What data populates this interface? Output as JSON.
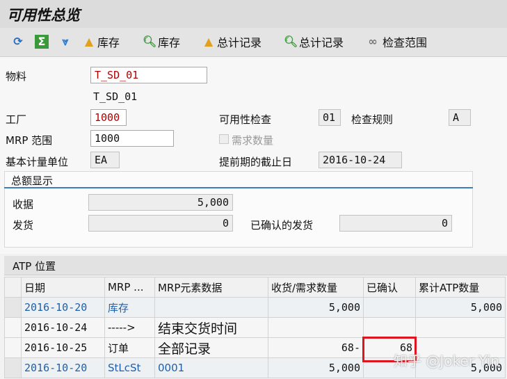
{
  "title": "可用性总览",
  "toolbar": {
    "items": [
      {
        "icon": "refresh-icon",
        "label": ""
      },
      {
        "icon": "sum-icon",
        "label": ""
      },
      {
        "icon": "filter-icon",
        "label": ""
      },
      {
        "icon": "mountain-icon",
        "label": "库存"
      },
      {
        "icon": "detail-icon",
        "label": "库存"
      },
      {
        "icon": "mountain-icon",
        "label": "总计记录"
      },
      {
        "icon": "detail-icon",
        "label": "总计记录"
      },
      {
        "icon": "glasses-icon",
        "label": "检查范围"
      }
    ]
  },
  "form": {
    "material_label": "物料",
    "material": "T_SD_01",
    "material_desc": "T_SD_01",
    "plant_label": "工厂",
    "plant": "1000",
    "check_label": "可用性检查",
    "check": "01",
    "rule_label": "检查规则",
    "rule": "A",
    "mrp_area_label": "MRP 范围",
    "mrp_area": "1000",
    "req_qty_label": "需求数量",
    "uom_label": "基本计量单位",
    "uom": "EA",
    "cutoff_label": "提前期的截止日",
    "cutoff": "2016-10-24"
  },
  "totals": {
    "title": "总额显示",
    "receipts_label": "收据",
    "receipts": "5,000",
    "issues_label": "发货",
    "issues": "0",
    "confirmed_label": "已确认的发货",
    "confirmed": "0"
  },
  "atp": {
    "title": "ATP 位置",
    "columns": [
      "日期",
      "MRP ...",
      "MRP元素数据",
      "收货/需求数量",
      "已确认",
      "累计ATP数量"
    ],
    "rows": [
      [
        "2016-10-20",
        "库存",
        "",
        "5,000",
        "",
        "5,000"
      ],
      [
        "2016-10-24",
        "----->",
        "结束交货时间",
        "",
        "",
        ""
      ],
      [
        "2016-10-25",
        "订单",
        "全部记录",
        "68-",
        "68",
        ""
      ],
      [
        "2016-10-20",
        "StLcSt",
        "0001",
        "5,000",
        "",
        "5,000"
      ]
    ]
  },
  "watermark": "知乎 @Joker Yin"
}
